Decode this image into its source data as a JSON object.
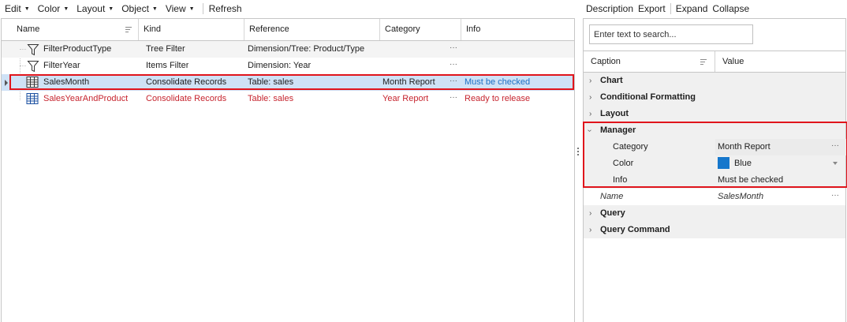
{
  "toolbar": {
    "menus": [
      "Edit",
      "Color",
      "Layout",
      "Object",
      "View"
    ],
    "refresh": "Refresh"
  },
  "grid": {
    "columns": [
      "Name",
      "Kind",
      "Reference",
      "Category",
      "Info"
    ],
    "rows": [
      {
        "name": "FilterProductType",
        "kind": "Tree Filter",
        "reference": "Dimension/Tree: Product/Type",
        "category": "",
        "info": ""
      },
      {
        "name": "FilterYear",
        "kind": "Items Filter",
        "reference": "Dimension: Year",
        "category": "",
        "info": ""
      },
      {
        "name": "SalesMonth",
        "kind": "Consolidate Records",
        "reference": "Table: sales",
        "category": "Month Report",
        "info": "Must be checked"
      },
      {
        "name": "SalesYearAndProduct",
        "kind": "Consolidate Records",
        "reference": "Table: sales",
        "category": "Year Report",
        "info": "Ready to release"
      }
    ],
    "ellipsis": "···"
  },
  "properties": {
    "toolbar": [
      "Description",
      "Export",
      "Expand",
      "Collapse"
    ],
    "search_placeholder": "Enter text to search...",
    "columns": [
      "Caption",
      "Value"
    ],
    "groups": {
      "chart": "Chart",
      "conditional_formatting": "Conditional Formatting",
      "layout": "Layout",
      "manager": "Manager",
      "query": "Query",
      "query_command": "Query Command"
    },
    "manager_items": [
      {
        "caption": "Category",
        "value": "Month Report"
      },
      {
        "caption": "Color",
        "value": "Blue",
        "swatch": "#1677cc"
      },
      {
        "caption": "Info",
        "value": "Must be checked"
      }
    ],
    "name_row": {
      "caption": "Name",
      "value": "SalesMonth"
    },
    "ellipsis": "···"
  },
  "colors": {
    "highlight": "#e0151c",
    "selected_row": "#cfe2f6",
    "red_text": "#c6242e",
    "blue_text": "#1b6fc4"
  }
}
